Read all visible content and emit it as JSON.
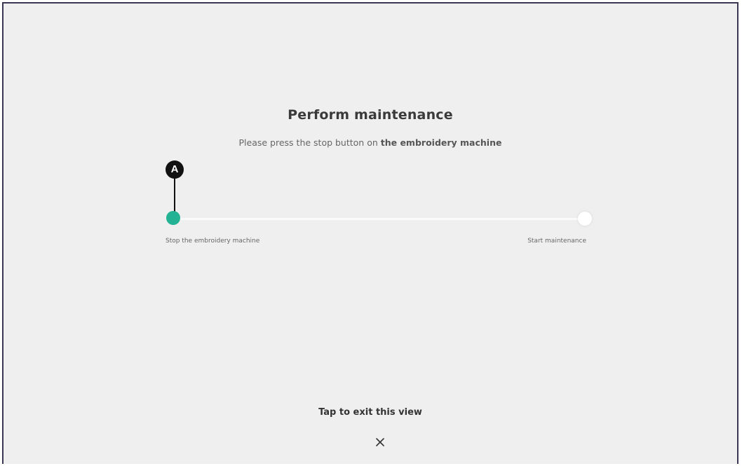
{
  "page": {
    "title": "Perform maintenance",
    "subtitle_prefix": "Please press the stop button on ",
    "subtitle_emphasis": "the embroidery machine"
  },
  "stepper": {
    "progress_fraction": 0.0,
    "current_step": 1,
    "steps": [
      {
        "label": "Stop the embroidery machine",
        "state": "active"
      },
      {
        "label": "Start maintenance",
        "state": "pending"
      }
    ],
    "active_color": "#23b394",
    "pending_color": "#ffffff"
  },
  "callout": {
    "letter": "A"
  },
  "footer": {
    "exit_text": "Tap to exit this view",
    "close_icon": "close-icon"
  }
}
